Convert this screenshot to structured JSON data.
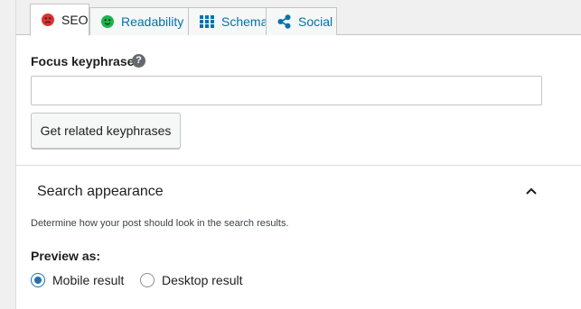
{
  "tabs": [
    {
      "label": "SEO",
      "icon": "sad-face-icon",
      "icon_color": "#dc3232",
      "active": true
    },
    {
      "label": "Readability",
      "icon": "smiley-face-icon",
      "icon_color": "#1ab54a",
      "active": false
    },
    {
      "label": "Schema",
      "icon": "grid-icon",
      "icon_color": "#0073aa",
      "active": false
    },
    {
      "label": "Social",
      "icon": "share-icon",
      "icon_color": "#0073aa",
      "active": false
    }
  ],
  "focus": {
    "label": "Focus keyphrase",
    "help": "?",
    "value": "",
    "button": "Get related keyphrases"
  },
  "search_appearance": {
    "title": "Search appearance",
    "description": "Determine how your post should look in the search results.",
    "preview_label": "Preview as:",
    "options": [
      {
        "label": "Mobile result",
        "checked": true
      },
      {
        "label": "Desktop result",
        "checked": false
      }
    ]
  }
}
